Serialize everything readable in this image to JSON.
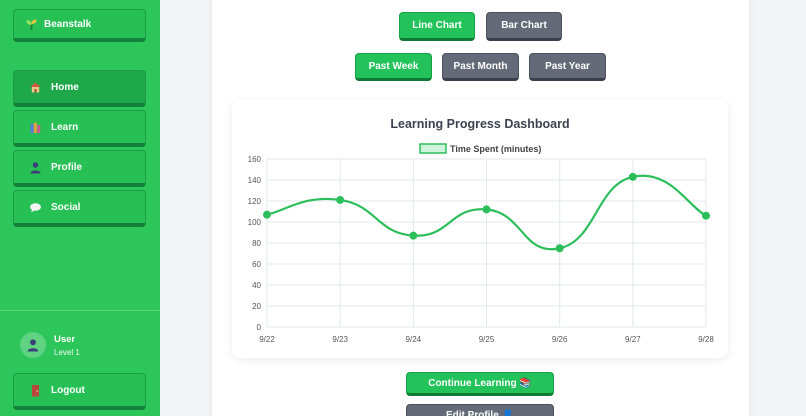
{
  "sidebar": {
    "brand": "Beanstalk",
    "nav": [
      {
        "label": "Home",
        "icon": "house-icon",
        "active": true
      },
      {
        "label": "Learn",
        "icon": "books-icon",
        "active": false
      },
      {
        "label": "Profile",
        "icon": "person-icon",
        "active": false
      },
      {
        "label": "Social",
        "icon": "speech-bubble-icon",
        "active": false
      }
    ],
    "user": {
      "name": "User",
      "level": "Level 1"
    },
    "logout_label": "Logout"
  },
  "toolbar": {
    "chart_types": [
      {
        "label": "Line Chart",
        "active": true
      },
      {
        "label": "Bar Chart",
        "active": false
      }
    ],
    "ranges": [
      {
        "label": "Past Week",
        "active": true
      },
      {
        "label": "Past Month",
        "active": false
      },
      {
        "label": "Past Year",
        "active": false
      }
    ]
  },
  "chart_data": {
    "type": "line",
    "title": "Learning Progress Dashboard",
    "categories": [
      "9/22",
      "9/23",
      "9/24",
      "9/25",
      "9/26",
      "9/27",
      "9/28"
    ],
    "series": [
      {
        "name": "Time Spent (minutes)",
        "values": [
          107,
          121,
          87,
          112,
          75,
          143,
          106
        ]
      }
    ],
    "ylim": [
      0,
      160
    ],
    "yticks": [
      0,
      20,
      40,
      60,
      80,
      100,
      120,
      140,
      160
    ],
    "grid": true,
    "legend": "top",
    "colors": {
      "line": "#2dbe5c",
      "fill": "#cdf3da",
      "grid": "#e5e7eb",
      "axis_text": "#555555"
    }
  },
  "actions": {
    "continue_label": "Continue Learning 📚",
    "edit_label": "Edit Profile 👤"
  },
  "colors": {
    "sidebar": "#2dc65a",
    "accent_green": "#23c25a",
    "neutral_gray": "#646a78"
  }
}
